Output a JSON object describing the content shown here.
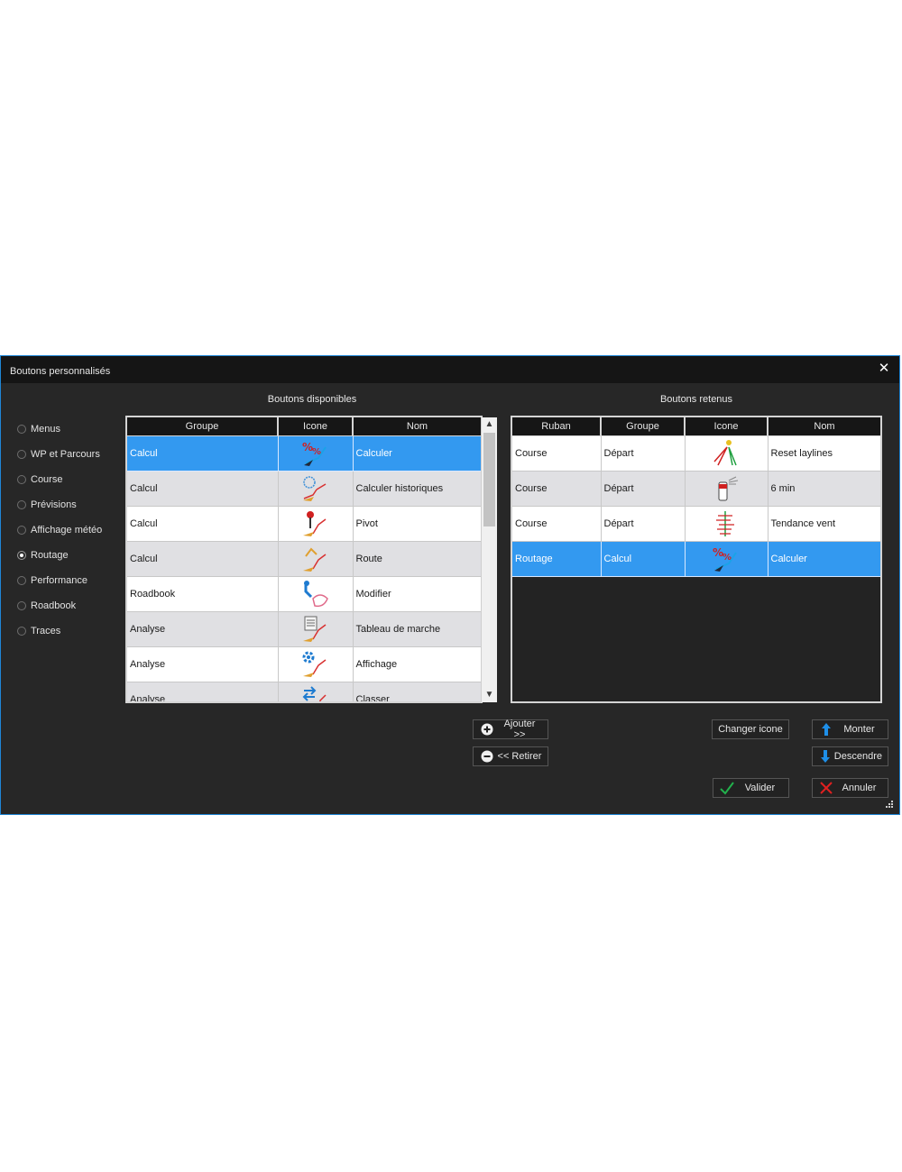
{
  "dialog": {
    "title": "Boutons personnalisés",
    "close_glyph": "✕"
  },
  "sidebar": {
    "selected": "Routage",
    "items": [
      {
        "label": "Menus",
        "checked": false
      },
      {
        "label": "WP et Parcours",
        "checked": false
      },
      {
        "label": "Course",
        "checked": false
      },
      {
        "label": "Prévisions",
        "checked": false
      },
      {
        "label": "Affichage météo",
        "checked": false
      },
      {
        "label": "Routage",
        "checked": true
      },
      {
        "label": "Performance",
        "checked": false
      },
      {
        "label": "Roadbook",
        "checked": false
      },
      {
        "label": "Traces",
        "checked": false
      }
    ]
  },
  "available": {
    "title": "Boutons disponibles",
    "columns": [
      "Groupe",
      "Icone",
      "Nom"
    ],
    "rows": [
      {
        "groupe": "Calcul",
        "icon": "calculer-icon",
        "nom": "Calculer",
        "selected": true
      },
      {
        "groupe": "Calcul",
        "icon": "calculer-historiques-icon",
        "nom": "Calculer historiques",
        "selected": false
      },
      {
        "groupe": "Calcul",
        "icon": "pivot-icon",
        "nom": "Pivot",
        "selected": false
      },
      {
        "groupe": "Calcul",
        "icon": "route-icon",
        "nom": "Route",
        "selected": false
      },
      {
        "groupe": "Roadbook",
        "icon": "modifier-icon",
        "nom": "Modifier",
        "selected": false
      },
      {
        "groupe": "Analyse",
        "icon": "tableau-de-marche-icon",
        "nom": "Tableau de marche",
        "selected": false
      },
      {
        "groupe": "Analyse",
        "icon": "affichage-icon",
        "nom": "Affichage",
        "selected": false
      },
      {
        "groupe": "Analyse",
        "icon": "classer-icon",
        "nom": "Classer",
        "selected": false
      }
    ]
  },
  "retained": {
    "title": "Boutons retenus",
    "columns": [
      "Ruban",
      "Groupe",
      "Icone",
      "Nom"
    ],
    "rows": [
      {
        "ruban": "Course",
        "groupe": "Départ",
        "icon": "reset-laylines-icon",
        "nom": "Reset laylines",
        "selected": false
      },
      {
        "ruban": "Course",
        "groupe": "Départ",
        "icon": "six-min-icon",
        "nom": "6 min",
        "selected": false
      },
      {
        "ruban": "Course",
        "groupe": "Départ",
        "icon": "tendance-vent-icon",
        "nom": "Tendance vent",
        "selected": false
      },
      {
        "ruban": "Routage",
        "groupe": "Calcul",
        "icon": "calculer-icon",
        "nom": "Calculer",
        "selected": true
      }
    ]
  },
  "buttons": {
    "add": "Ajouter >>",
    "remove": "<< Retirer",
    "change_icon": "Changer icone",
    "up": "Monter",
    "down": "Descendre",
    "ok": "Valider",
    "cancel": "Annuler"
  },
  "colors": {
    "selection": "#3399f0",
    "accent": "#1f86d6",
    "background": "#272727",
    "ok_green": "#22b14c",
    "cancel_red": "#e02020"
  }
}
